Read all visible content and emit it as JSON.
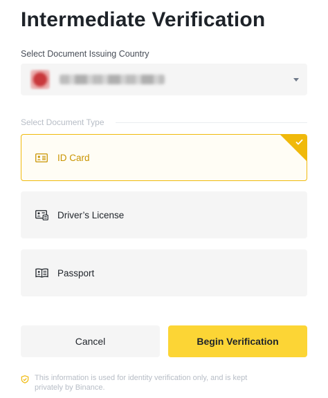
{
  "header": {
    "title": "Intermediate Verification"
  },
  "country": {
    "label": "Select Document Issuing Country",
    "flag_icon": "country-flag-icon",
    "caret_icon": "caret-down-icon"
  },
  "document_type": {
    "label": "Select Document Type",
    "options": [
      {
        "label": "ID Card",
        "icon": "id-card-icon",
        "selected": true
      },
      {
        "label": "Driver’s License",
        "icon": "drivers-license-icon",
        "selected": false
      },
      {
        "label": "Passport",
        "icon": "passport-icon",
        "selected": false
      }
    ],
    "selected_check_icon": "checkmark-icon"
  },
  "actions": {
    "cancel_label": "Cancel",
    "begin_label": "Begin Verification"
  },
  "notice": {
    "icon": "shield-check-icon",
    "text": "This information is used for identity verification only, and is kept privately by Binance."
  },
  "colors": {
    "accent": "#f0b90b",
    "accent_text": "#c99400",
    "primary_button": "#fcd535",
    "surface": "#f5f5f5",
    "text_primary": "#1e2329",
    "text_muted": "#b7bdc6"
  }
}
